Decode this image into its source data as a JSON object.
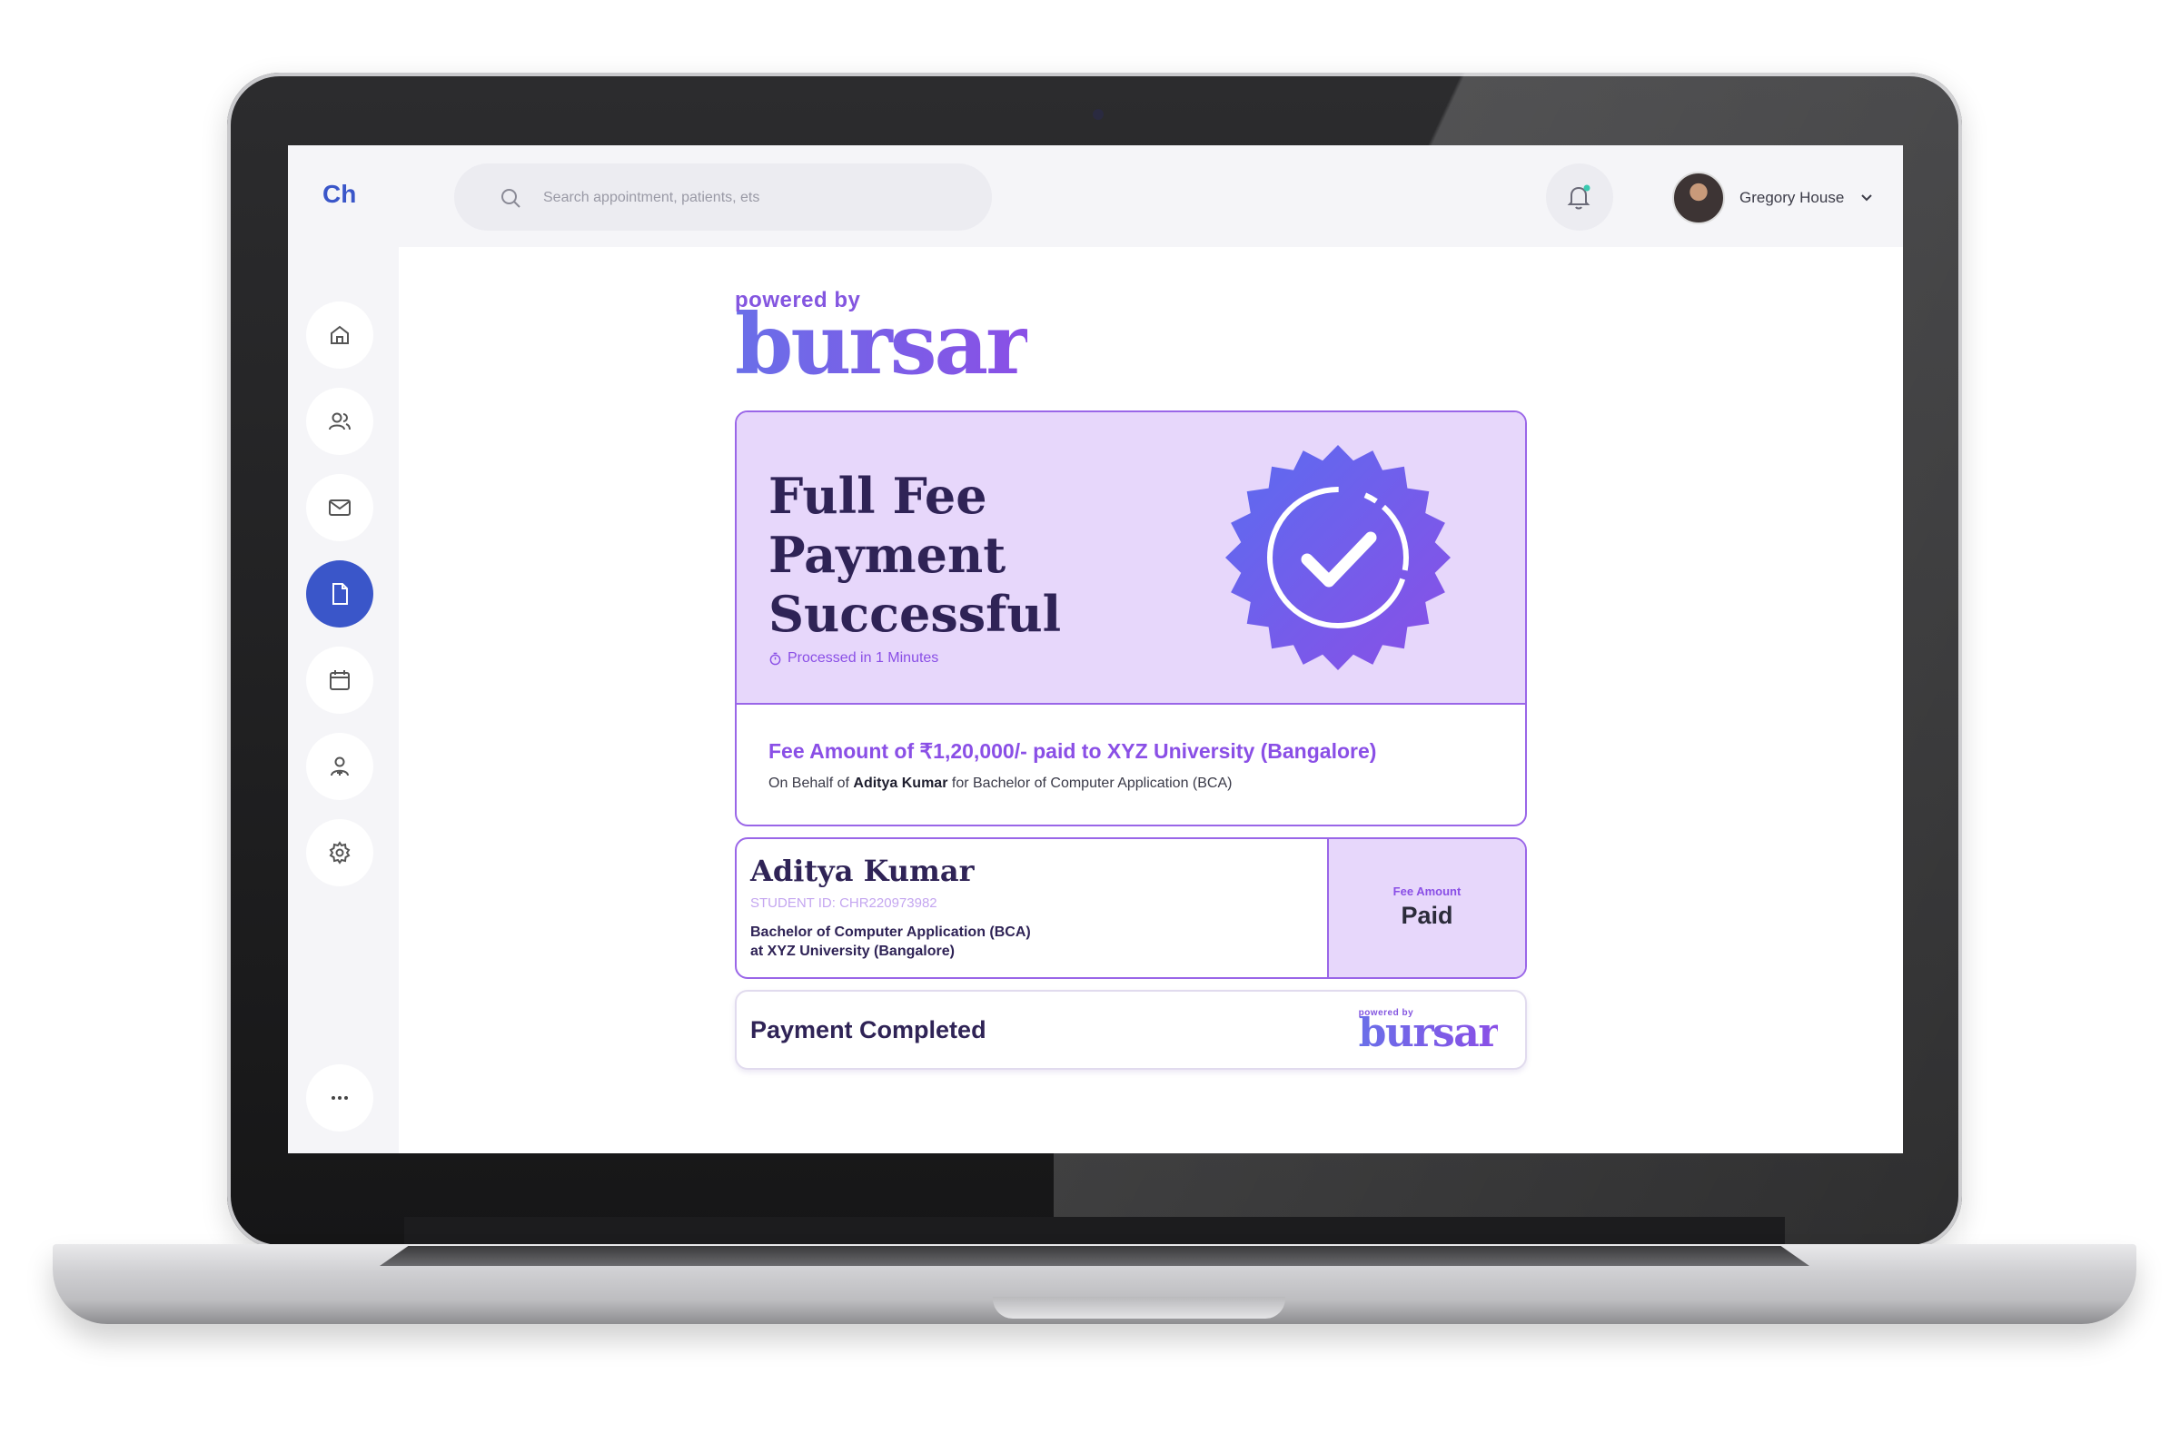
{
  "app": {
    "brand": "Ch"
  },
  "search": {
    "placeholder": "Search appointment, patients, ets"
  },
  "user": {
    "name": "Gregory House"
  },
  "sidebar": {
    "items": [
      {
        "icon": "home-icon"
      },
      {
        "icon": "users-icon"
      },
      {
        "icon": "mail-icon"
      },
      {
        "icon": "document-icon",
        "active": true
      },
      {
        "icon": "calendar-icon"
      },
      {
        "icon": "add-user-icon"
      },
      {
        "icon": "settings-icon"
      },
      {
        "icon": "more-icon"
      }
    ]
  },
  "logo": {
    "powered_by": "powered by",
    "name": "bursar"
  },
  "payment": {
    "headline": [
      "Full Fee",
      "Payment",
      "Successful"
    ],
    "processed": "Processed in 1 Minutes",
    "fee_line": "Fee Amount of ₹1,20,000/- paid to XYZ University (Bangalore)",
    "behalf_prefix": "On Behalf of",
    "behalf_name": "Aditya Kumar",
    "behalf_suffix": "for Bachelor of Computer Application (BCA)"
  },
  "student": {
    "name": "Aditya Kumar",
    "id": "STUDENT ID: CHR220973982",
    "program": "Bachelor of Computer Application (BCA)",
    "university": "at XYZ University (Bangalore)",
    "fee_label": "Fee Amount",
    "fee_status": "Paid"
  },
  "completion": {
    "label": "Payment Completed"
  },
  "colors": {
    "accent_blue": "#3a56c9",
    "purple": "#8a4fe6",
    "lavender": "#e7d7fb",
    "navy_text": "#2f2356"
  }
}
